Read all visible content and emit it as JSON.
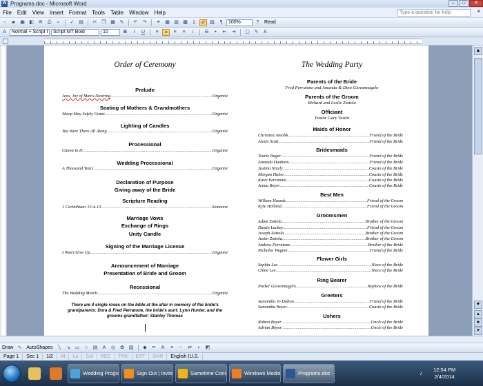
{
  "window": {
    "title": "Programs.doc - Microsoft Word"
  },
  "menu": {
    "items": [
      "File",
      "Edit",
      "View",
      "Insert",
      "Format",
      "Tools",
      "Table",
      "Window",
      "Help"
    ],
    "help_placeholder": "Type a question for help"
  },
  "toolbar": {
    "zoom": "100%",
    "read_label": "Read",
    "style": "Normal + Script I",
    "font": "Script MT Bold",
    "size": "10",
    "bold": "B",
    "italic": "I",
    "underline": "U"
  },
  "left": {
    "title": "Order of Ceremony",
    "prelude": "Prelude",
    "prelude_line": {
      "left": "Jesu, Joy of Man's Desiring",
      "right": "Organist"
    },
    "seating": "Seating of Mothers & Grandmothers",
    "seating_line": {
      "left": "Sheep May Safely Graze",
      "right": "Organist"
    },
    "candles": "Lighting of Candles",
    "candles_line": {
      "left": "You Were There All Along",
      "right": "Organist"
    },
    "processional": "Processional",
    "processional_line": {
      "left": "Canon in D",
      "right": "Organist"
    },
    "wedding_processional": "Wedding Processional",
    "wedding_processional_line": {
      "left": "A Thousand Years",
      "right": "Organist"
    },
    "declaration": "Declaration of Purpose",
    "giving": "Giving away of the Bride",
    "scripture": "Scripture Reading",
    "scripture_line": {
      "left": "1 Corinthians 13:4-13",
      "right": "Someone"
    },
    "vows": "Marriage Vows",
    "rings": "Exchange of Rings",
    "unity": "Unity Candle",
    "license": "Signing of the Marriage License",
    "license_line": {
      "left": "I Won't Give Up",
      "right": "Organist"
    },
    "announcement": "Announcement of Marriage",
    "presentation": "Presentation of Bride and Groom",
    "recessional": "Recessional",
    "recessional_line": {
      "left": "The Wedding March",
      "right": "Organist"
    },
    "note": "There are 4 single roses on the bible at the altar in memory of the bride's grandparents: Dora & Fred Perratone, the bride's aunt: Lynn Hunter, and the grooms grandfather: Stanley Thomas"
  },
  "right": {
    "title": "The Wedding Party",
    "parents_bride": "Parents of the Bride",
    "parents_bride_names": "Fred Perratone and Amanda & Dino Giovannagelo",
    "parents_groom": "Parents of the Groom",
    "parents_groom_names": "Richard and Leslie Zottola",
    "officiant": "Officiant",
    "officiant_name": "Pastor Gary Tustin",
    "maids": "Maids of Honor",
    "maids_list": [
      {
        "left": "Christina Antolik",
        "right": "Friend of the Bride"
      },
      {
        "left": "Alexis Scott",
        "right": "Friend of the Bride"
      }
    ],
    "bridesmaids": "Bridesmaids",
    "bridesmaids_list": [
      {
        "left": "Tracie Rager",
        "right": "Friend of the Bride"
      },
      {
        "left": "Amanda Dunham",
        "right": "Friend of the Bride"
      },
      {
        "left": "Justina Nicely",
        "right": "Cousin of the Bride"
      },
      {
        "left": "Morgan Huber",
        "right": "Cousin of the Bride"
      },
      {
        "left": "Katie Perratone",
        "right": "Cousin of the Bride"
      },
      {
        "left": "Jenna Boyer",
        "right": "Cousin of the Bride"
      }
    ],
    "best_men": "Best Men",
    "best_men_list": [
      {
        "left": "William Huszak",
        "right": "Friend of the Groom"
      },
      {
        "left": "Kyle Holland",
        "right": "Friend of the Groom"
      }
    ],
    "groomsmen": "Groomsmen",
    "groomsmen_list": [
      {
        "left": "Adam Zottola",
        "right": "Brother of the Groom"
      },
      {
        "left": "Dustin Lackey",
        "right": "Friend of the Groom"
      },
      {
        "left": "Joseph Zottola",
        "right": "Brother of the Groom"
      },
      {
        "left": "Justin Zottola",
        "right": "Brother of the Groom"
      },
      {
        "left": "Andrew Perratone",
        "right": "Brother of the Bride"
      },
      {
        "left": "Nicholas Wagner",
        "right": "Friend of the Bride"
      }
    ],
    "flower_girls": "Flower Girls",
    "flower_girls_list": [
      {
        "left": "Sophia Lee",
        "right": "Niece of the Bride"
      },
      {
        "left": "Chloe Lee",
        "right": "Niece of the Bride"
      }
    ],
    "ring_bearer": "Ring Bearer",
    "ring_bearer_list": [
      {
        "left": "Parker Giovannagelo",
        "right": "Nephew of the Bride"
      }
    ],
    "greeters": "Greeters",
    "greeters_list": [
      {
        "left": "Samantha Jo Dalton",
        "right": "Friend of the Bride"
      },
      {
        "left": "Samantha Boyer",
        "right": "Cousin of the Bride"
      }
    ],
    "ushers": "Ushers",
    "ushers_list": [
      {
        "left": "Robert Boyer",
        "right": "Uncle of the Bride"
      },
      {
        "left": "Adrian Boyer",
        "right": "Uncle of the Bride"
      }
    ]
  },
  "drawbar": {
    "draw": "Draw",
    "autoshapes": "AutoShapes"
  },
  "status": {
    "page": "Page 1",
    "sec": "Sec 1",
    "pages": "1/2",
    "at": "At",
    "ln": "Ln",
    "col": "Col",
    "rec": "REC",
    "trk": "TRK",
    "ext": "EXT",
    "ovr": "OVR",
    "lang": "English (U.S."
  },
  "taskbar": {
    "tasks": [
      "Wedding Progra...",
      "Sign Out | Invitati...",
      "Sametime Contac...",
      "Windows Media P...",
      "Programs.doc - ..."
    ],
    "time": "12:54 PM",
    "date": "2/4/2014"
  }
}
